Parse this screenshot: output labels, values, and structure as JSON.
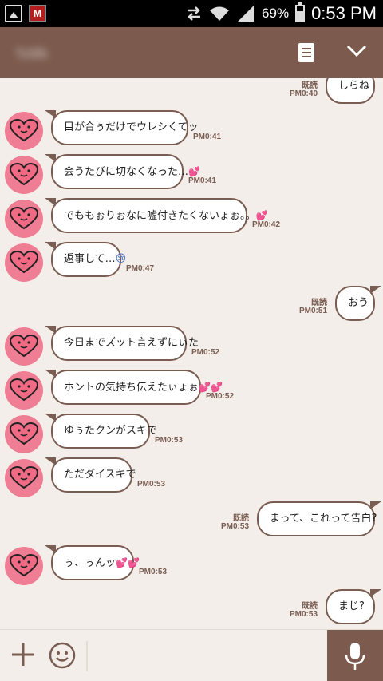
{
  "status_bar": {
    "battery_pct": "69%",
    "time": "0:53 PM",
    "icons": [
      "image-icon",
      "mcafee-icon",
      "data-transfer-icon",
      "wifi-icon",
      "signal-icon",
      "battery-icon"
    ]
  },
  "header": {
    "title": "ｳｪﾙｶﾑ",
    "accent_color": "#7c5a4d",
    "icons": [
      "note-icon",
      "chevron-down-icon"
    ]
  },
  "messages": [
    {
      "dir": "out",
      "text": "しらね",
      "read": "既読",
      "time": "PM0:40"
    },
    {
      "dir": "in",
      "text": "目が合ぅだけでウレシくてッ",
      "time": "PM0:41"
    },
    {
      "dir": "in",
      "text": "会うたびに切なくなった…",
      "hearts": "💕",
      "time": "PM0:41"
    },
    {
      "dir": "in",
      "text": "でももぉりぉなに嘘付きたくないょぉ。。",
      "hearts": "💕",
      "time": "PM0:42"
    },
    {
      "dir": "in",
      "text": "返事して…",
      "emoji": "😢",
      "time": "PM0:47"
    },
    {
      "dir": "out",
      "text": "おう",
      "read": "既読",
      "time": "PM0:51"
    },
    {
      "dir": "in",
      "text": "今日までズット言えずにぃた",
      "time": "PM0:52"
    },
    {
      "dir": "in",
      "text": "ホントの気持ち伝えたぃょぉ",
      "hearts": "💕💕",
      "time": "PM0:52"
    },
    {
      "dir": "in",
      "text": "ゆぅたクンがスキで",
      "time": "PM0:53"
    },
    {
      "dir": "in",
      "text": "ただダイスキで",
      "time": "PM0:53"
    },
    {
      "dir": "out",
      "text": "まって、これって告白?",
      "read": "既読",
      "time": "PM0:53"
    },
    {
      "dir": "in",
      "text": "ぅ、ぅんッ",
      "hearts": "💕💕",
      "time": "PM0:53"
    },
    {
      "dir": "out",
      "text": "まじ?",
      "read": "既読",
      "time": "PM0:53"
    }
  ],
  "input": {
    "placeholder": "",
    "icons": [
      "plus-icon",
      "smile-icon",
      "microphone-icon"
    ]
  },
  "colors": {
    "background": "#f3eee9",
    "avatar": "#ef7d93",
    "bubble_border": "#7a5d52"
  }
}
